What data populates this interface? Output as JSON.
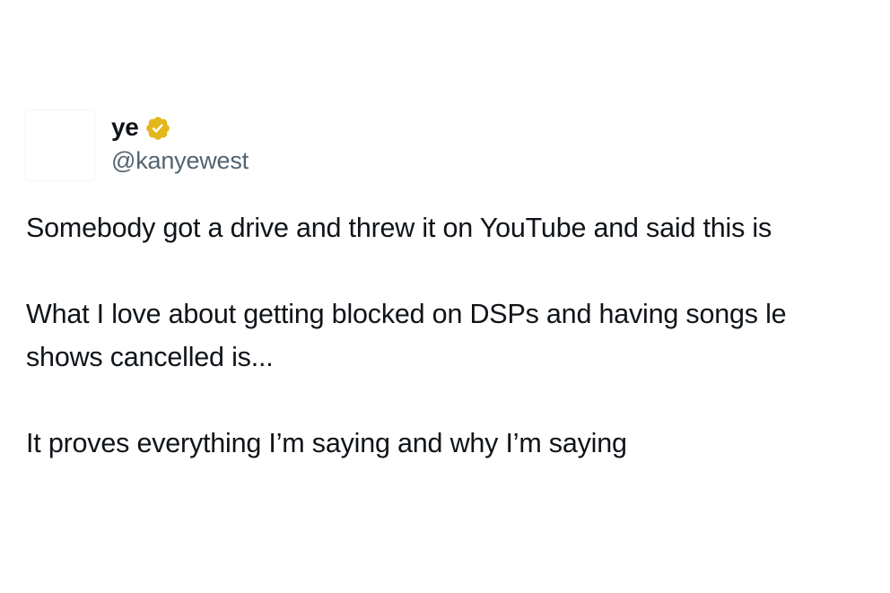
{
  "author": {
    "display_name": "ye",
    "handle": "@kanyewest",
    "verified_icon": "verified-badge-gold",
    "verified_color": "#e2b719"
  },
  "tweet": {
    "lines": [
      "Somebody got a drive and threw it on YouTube and said this is",
      "What I love about getting blocked on DSPs and having songs le",
      "shows cancelled is...",
      "It proves everything I’m saying and why I’m saying"
    ]
  },
  "colors": {
    "text": "#0f1419",
    "secondary_text": "#536471",
    "background": "#ffffff"
  }
}
